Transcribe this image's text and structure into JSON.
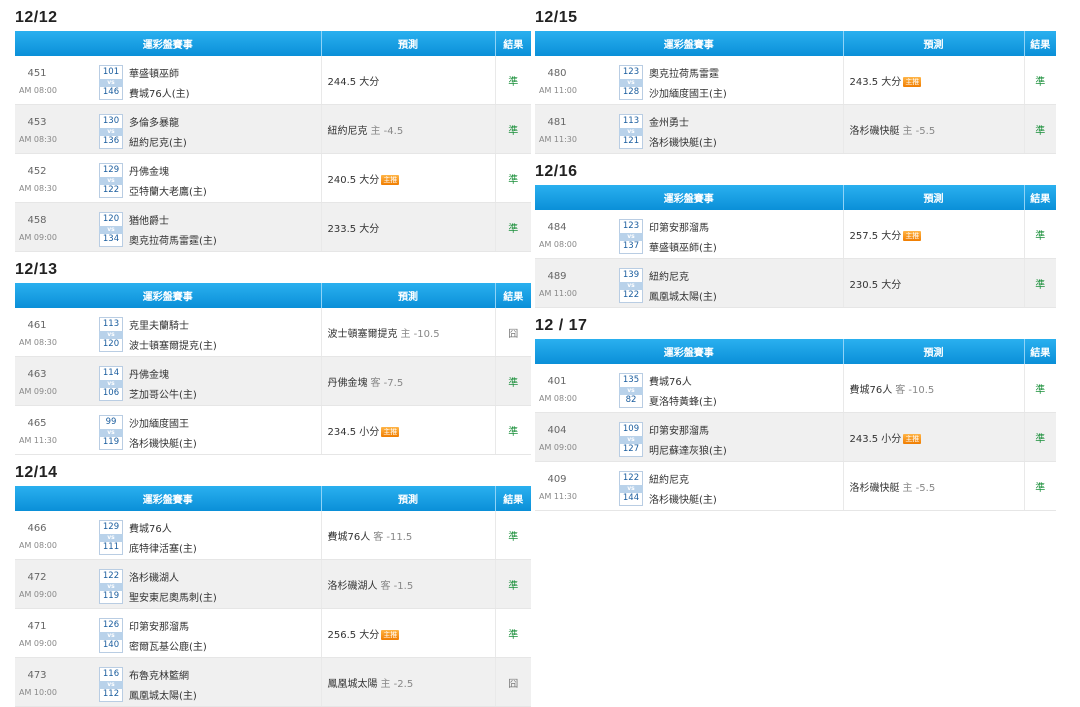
{
  "headers": {
    "game": "運彩盤賽事",
    "prediction": "預測",
    "result": "結果"
  },
  "badge_label": "主推",
  "vs_label": "vs",
  "left_days": [
    {
      "date": "12/12",
      "games": [
        {
          "id": "451",
          "time": "AM 08:00",
          "away_no": "101",
          "away": "華盛頓巫師",
          "home_no": "146",
          "home": "費城76人(主)",
          "pick": "244.5 大分",
          "sub": "",
          "badge": false,
          "result": "準",
          "win": true
        },
        {
          "id": "453",
          "time": "AM 08:30",
          "away_no": "130",
          "away": "多倫多暴龍",
          "home_no": "136",
          "home": "紐約尼克(主)",
          "pick": "紐約尼克",
          "sub": "主 -4.5",
          "badge": false,
          "result": "準",
          "win": true
        },
        {
          "id": "452",
          "time": "AM 08:30",
          "away_no": "129",
          "away": "丹佛金塊",
          "home_no": "122",
          "home": "亞特蘭大老鷹(主)",
          "pick": "240.5 大分",
          "sub": "",
          "badge": true,
          "result": "準",
          "win": true
        },
        {
          "id": "458",
          "time": "AM 09:00",
          "away_no": "120",
          "away": "猶他爵士",
          "home_no": "134",
          "home": "奧克拉荷馬雷霆(主)",
          "pick": "233.5 大分",
          "sub": "",
          "badge": false,
          "result": "準",
          "win": true
        }
      ]
    },
    {
      "date": "12/13",
      "games": [
        {
          "id": "461",
          "time": "AM 08:30",
          "away_no": "113",
          "away": "克里夫蘭騎士",
          "home_no": "120",
          "home": "波士頓塞爾提克(主)",
          "pick": "波士頓塞爾提克",
          "sub": "主 -10.5",
          "badge": false,
          "result": "囧",
          "win": false
        },
        {
          "id": "463",
          "time": "AM 09:00",
          "away_no": "114",
          "away": "丹佛金塊",
          "home_no": "106",
          "home": "芝加哥公牛(主)",
          "pick": "丹佛金塊",
          "sub": "客 -7.5",
          "badge": false,
          "result": "準",
          "win": true
        },
        {
          "id": "465",
          "time": "AM 11:30",
          "away_no": "99",
          "away": "沙加緬度國王",
          "home_no": "119",
          "home": "洛杉磯快艇(主)",
          "pick": "234.5 小分",
          "sub": "",
          "badge": true,
          "result": "準",
          "win": true
        }
      ]
    },
    {
      "date": "12/14",
      "games": [
        {
          "id": "466",
          "time": "AM 08:00",
          "away_no": "129",
          "away": "費城76人",
          "home_no": "111",
          "home": "底特律活塞(主)",
          "pick": "費城76人",
          "sub": "客 -11.5",
          "badge": false,
          "result": "準",
          "win": true
        },
        {
          "id": "472",
          "time": "AM 09:00",
          "away_no": "122",
          "away": "洛杉磯湖人",
          "home_no": "119",
          "home": "聖安東尼奧馬刺(主)",
          "pick": "洛杉磯湖人",
          "sub": "客 -1.5",
          "badge": false,
          "result": "準",
          "win": true
        },
        {
          "id": "471",
          "time": "AM 09:00",
          "away_no": "126",
          "away": "印第安那溜馬",
          "home_no": "140",
          "home": "密爾瓦基公鹿(主)",
          "pick": "256.5 大分",
          "sub": "",
          "badge": true,
          "result": "準",
          "win": true
        },
        {
          "id": "473",
          "time": "AM 10:00",
          "away_no": "116",
          "away": "布魯克林籃網",
          "home_no": "112",
          "home": "鳳凰城太陽(主)",
          "pick": "鳳凰城太陽",
          "sub": "主 -2.5",
          "badge": false,
          "result": "囧",
          "win": false
        }
      ]
    }
  ],
  "right_days": [
    {
      "date": "12/15",
      "games": [
        {
          "id": "480",
          "time": "AM 11:00",
          "away_no": "123",
          "away": "奧克拉荷馬雷霆",
          "home_no": "128",
          "home": "沙加緬度國王(主)",
          "pick": "243.5 大分",
          "sub": "",
          "badge": true,
          "result": "準",
          "win": true
        },
        {
          "id": "481",
          "time": "AM 11:30",
          "away_no": "113",
          "away": "金州勇士",
          "home_no": "121",
          "home": "洛杉磯快艇(主)",
          "pick": "洛杉磯快艇",
          "sub": "主 -5.5",
          "badge": false,
          "result": "準",
          "win": true
        }
      ]
    },
    {
      "date": "12/16",
      "games": [
        {
          "id": "484",
          "time": "AM 08:00",
          "away_no": "123",
          "away": "印第安那溜馬",
          "home_no": "137",
          "home": "華盛頓巫師(主)",
          "pick": "257.5 大分",
          "sub": "",
          "badge": true,
          "result": "準",
          "win": true
        },
        {
          "id": "489",
          "time": "AM 11:00",
          "away_no": "139",
          "away": "紐約尼克",
          "home_no": "122",
          "home": "鳳凰城太陽(主)",
          "pick": "230.5 大分",
          "sub": "",
          "badge": false,
          "result": "準",
          "win": true
        }
      ]
    },
    {
      "date": "12 / 17",
      "games": [
        {
          "id": "401",
          "time": "AM 08:00",
          "away_no": "135",
          "away": "費城76人",
          "home_no": "82",
          "home": "夏洛特黃蜂(主)",
          "pick": "費城76人",
          "sub": "客 -10.5",
          "badge": false,
          "result": "準",
          "win": true
        },
        {
          "id": "404",
          "time": "AM 09:00",
          "away_no": "109",
          "away": "印第安那溜馬",
          "home_no": "127",
          "home": "明尼蘇達灰狼(主)",
          "pick": "243.5 小分",
          "sub": "",
          "badge": true,
          "result": "準",
          "win": true
        },
        {
          "id": "409",
          "time": "AM 11:30",
          "away_no": "122",
          "away": "紐約尼克",
          "home_no": "144",
          "home": "洛杉磯快艇(主)",
          "pick": "洛杉磯快艇",
          "sub": "主 -5.5",
          "badge": false,
          "result": "準",
          "win": true
        }
      ]
    }
  ]
}
